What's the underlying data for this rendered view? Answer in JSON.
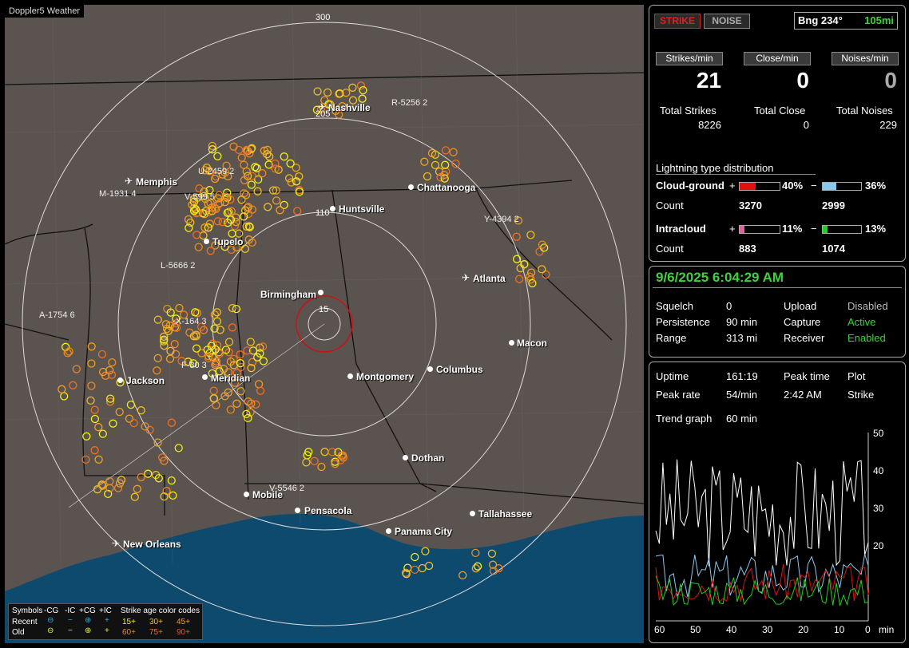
{
  "app_title": "Doppler5 Weather",
  "header": {
    "strike_btn": "STRIKE",
    "noise_btn": "NOISE",
    "bearing_label": "Bng 234°",
    "bearing_dist": "105mi"
  },
  "counters": {
    "strikes_hdr": "Strikes/min",
    "close_hdr": "Close/min",
    "noises_hdr": "Noises/min",
    "strikes_val": "21",
    "close_val": "0",
    "noises_val": "0",
    "total_strikes_lbl": "Total Strikes",
    "total_close_lbl": "Total Close",
    "total_noises_lbl": "Total Noises",
    "total_strikes": "8226",
    "total_close": "0",
    "total_noises": "229"
  },
  "distribution": {
    "title": "Lightning type distribution",
    "cg_label": "Cloud-ground",
    "ic_label": "Intracloud",
    "count_label": "Count",
    "plus": "+",
    "minus": "−",
    "cg_pos_pct": "40%",
    "cg_neg_pct": "36%",
    "ic_pos_pct": "11%",
    "ic_neg_pct": "13%",
    "cg_pos_frac": 0.4,
    "cg_neg_frac": 0.36,
    "ic_pos_frac": 0.11,
    "ic_neg_frac": 0.13,
    "cg_pos_count": "3270",
    "cg_neg_count": "2999",
    "ic_pos_count": "883",
    "ic_neg_count": "1074",
    "colors": {
      "cg_pos": "#e01010",
      "cg_neg": "#8ac8f0",
      "ic_pos": "#e060a0",
      "ic_neg": "#20d020"
    }
  },
  "status": {
    "datetime": "9/6/2025 6:04:29 AM",
    "squelch_lbl": "Squelch",
    "squelch": "0",
    "persistence_lbl": "Persistence",
    "persistence": "90 min",
    "range_lbl": "Range",
    "range": "313 mi",
    "upload_lbl": "Upload",
    "upload": "Disabled",
    "capture_lbl": "Capture",
    "capture": "Active",
    "receiver_lbl": "Receiver",
    "receiver": "Enabled"
  },
  "stats": {
    "uptime_lbl": "Uptime",
    "uptime": "161:19",
    "peak_time_lbl": "Peak time",
    "peak_time": "2:42 AM",
    "plot_lbl": "Plot",
    "plot": "Strike",
    "peak_rate_lbl": "Peak rate",
    "peak_rate": "54/min",
    "trend_lbl": "Trend graph",
    "trend": "60 min"
  },
  "trend_axis": {
    "x_ticks": [
      "60",
      "50",
      "40",
      "30",
      "20",
      "10",
      "0"
    ],
    "x_unit": "min",
    "y_ticks": [
      "50",
      "40",
      "30",
      "20"
    ]
  },
  "map": {
    "cities": [
      "Nashville",
      "Memphis",
      "Huntsville",
      "Chattanooga",
      "Tupelo",
      "Atlanta",
      "Birmingham",
      "Macon",
      "Montgomery",
      "Columbus",
      "Jackson",
      "Meridian",
      "Dothan",
      "Mobile",
      "Pensacola",
      "Tallahassee",
      "Panama City",
      "New Orleans"
    ],
    "station_labels": [
      "R-5256 2",
      "U-2459 2",
      "M-1931 4",
      "V-599 5",
      "Y-4394 2",
      "L-5666 2",
      "A-1754 6",
      "X-164 3",
      "F-30 3",
      "V-5546 2"
    ],
    "ring_labels": [
      "300",
      "205",
      "110",
      "15"
    ]
  },
  "legend": {
    "symbols": "Symbols",
    "types": [
      "-CG",
      "-IC",
      "+CG",
      "+IC"
    ],
    "age_title": "Strike age color codes",
    "recent": "Recent",
    "old": "Old",
    "recent_ages": [
      "15+",
      "30+",
      "45+"
    ],
    "old_ages": [
      "60+",
      "75+",
      "90+"
    ]
  }
}
